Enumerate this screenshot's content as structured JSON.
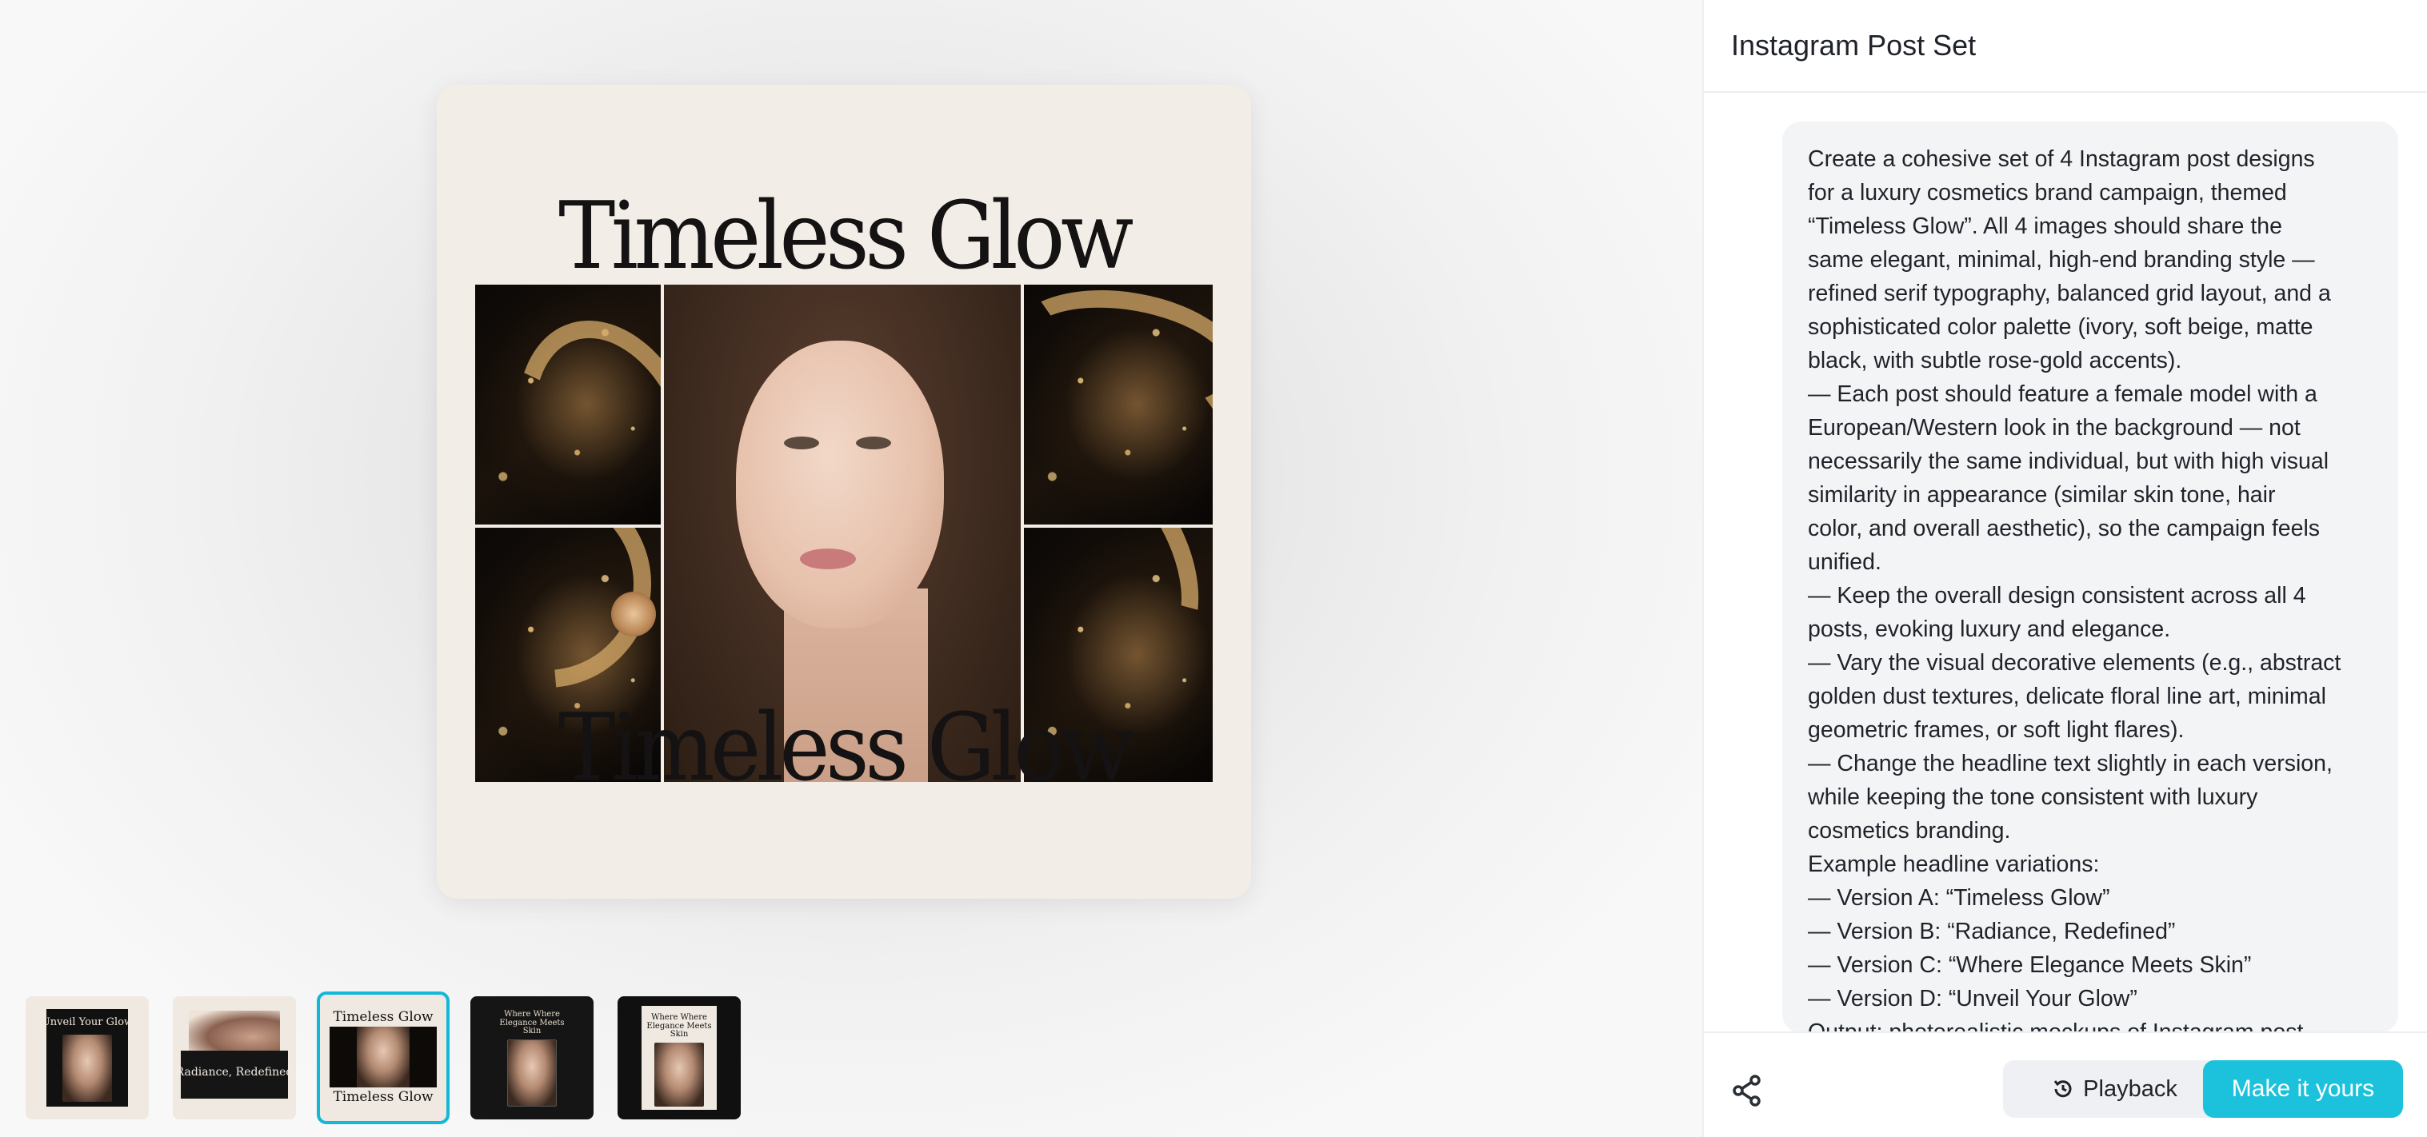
{
  "main_image": {
    "headline_top": "Timeless Glow",
    "headline_bottom": "Timeless Glow"
  },
  "thumbnails": [
    {
      "label": "Unveil Your Glow",
      "bg": "#111111",
      "selected": false
    },
    {
      "label": "Radiance, Redefined",
      "bg": "#efe9e1",
      "selected": false
    },
    {
      "label": "Timeless Glow",
      "label_bottom": "Timeless Glow",
      "bg": "#efe9e1",
      "selected": true
    },
    {
      "label": "Where Where Elegance Meets Skin",
      "bg": "#151515",
      "selected": false
    },
    {
      "label": "Where Where Elegance Meets Skin",
      "bg": "#101010",
      "selected": false
    }
  ],
  "panel": {
    "title": "Instagram Post Set",
    "prompt_lines": [
      "Create a cohesive set of 4 Instagram post designs",
      "for a luxury cosmetics brand campaign, themed",
      "“Timeless Glow”. All 4 images should share the",
      "same elegant, minimal, high-end branding style —",
      "refined serif typography, balanced grid layout, and a",
      "sophisticated color palette (ivory, soft beige, matte",
      "black, with subtle rose-gold accents).",
      "— Each post should feature a female model with a",
      "European/Western look in the background — not",
      "necessarily the same individual, but with high visual",
      "similarity in appearance (similar skin tone, hair",
      "color, and overall aesthetic), so the campaign feels",
      "unified.",
      "— Keep the overall design consistent across all 4",
      "posts, evoking luxury and elegance.",
      "— Vary the visual decorative elements (e.g., abstract",
      "golden dust textures, delicate floral line art, minimal",
      "geometric frames, or soft light flares).",
      "— Change the headline text slightly in each version,",
      "while keeping the tone consistent with luxury",
      "cosmetics branding.",
      "Example headline variations:",
      "— Version A: “Timeless Glow”",
      "— Version B: “Radiance, Redefined”",
      "— Version C: “Where Elegance Meets Skin”",
      "— Version D: “Unveil Your Glow”",
      "Output: photorealistic mockups of Instagram post"
    ]
  },
  "footer": {
    "share_icon": "share-icon",
    "playback_label": "Playback",
    "playback_icon": "history-icon",
    "make_label": "Make it yours"
  },
  "colors": {
    "accent": "#1cc2dc",
    "selected_outline": "#12b8d8",
    "card_bg": "#f2ede6"
  }
}
